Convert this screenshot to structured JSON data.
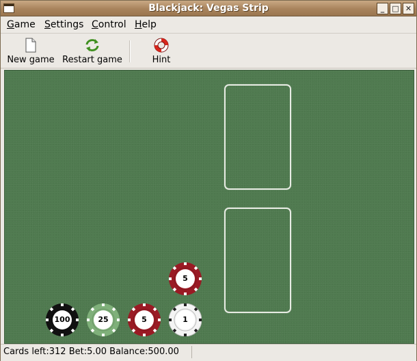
{
  "window": {
    "title": "Blackjack: Vegas Strip",
    "controls": {
      "minimize": "_",
      "maximize": "□",
      "close": "✕"
    }
  },
  "menubar": {
    "items": [
      {
        "label": "Game",
        "mnemonic": "G",
        "rest": "ame"
      },
      {
        "label": "Settings",
        "mnemonic": "S",
        "rest": "ettings"
      },
      {
        "label": "Control",
        "mnemonic": "C",
        "rest": "ontrol"
      },
      {
        "label": "Help",
        "mnemonic": "H",
        "rest": "elp"
      }
    ]
  },
  "toolbar": {
    "new_game": {
      "label": "New game",
      "icon": "new-document-icon"
    },
    "restart_game": {
      "label": "Restart game",
      "icon": "refresh-arrows-icon"
    },
    "hint": {
      "label": "Hint",
      "icon": "lifebuoy-icon"
    }
  },
  "table": {
    "felt_color": "#4f7a4f",
    "chips": [
      {
        "value": "100",
        "color": "#111111"
      },
      {
        "value": "25",
        "color": "#7fb07a"
      },
      {
        "value": "5",
        "color": "#9a1a24"
      },
      {
        "value": "1",
        "color": "#f4f4f4"
      },
      {
        "value": "5",
        "color": "#9a1a24"
      }
    ]
  },
  "statusbar": {
    "text": "Cards left:312  Bet:5.00  Balance:500.00"
  }
}
